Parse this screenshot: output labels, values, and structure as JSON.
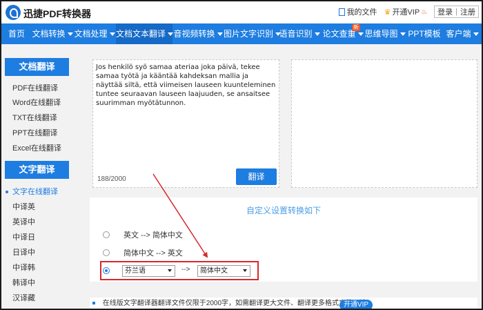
{
  "header": {
    "brand": "迅捷PDF转换器",
    "my_files": "我的文件",
    "open_vip": "开通VIP",
    "login": "登录",
    "sep": "|",
    "register": "注册"
  },
  "nav": {
    "items": [
      {
        "label": "首页",
        "caret": false
      },
      {
        "label": "文档转换",
        "caret": true
      },
      {
        "label": "文档处理",
        "caret": true
      },
      {
        "label": "文档文本翻译",
        "caret": true,
        "active": true
      },
      {
        "label": "音视频转换",
        "caret": true
      },
      {
        "label": "图片文字识别",
        "caret": true
      },
      {
        "label": "语音识别",
        "caret": true
      },
      {
        "label": "论文查重",
        "caret": true,
        "badge": "新"
      },
      {
        "label": "思维导图",
        "caret": true
      },
      {
        "label": "PPT模板",
        "caret": false
      },
      {
        "label": "客户端",
        "caret": true
      }
    ]
  },
  "sidebar": {
    "doc_heading": "文档翻译",
    "doc_items": [
      "PDF在线翻译",
      "Word在线翻译",
      "TXT在线翻译",
      "PPT在线翻译",
      "Excel在线翻译"
    ],
    "text_heading": "文字翻译",
    "text_items": [
      "文字在线翻译",
      "中译英",
      "英译中",
      "中译日",
      "日译中",
      "中译韩",
      "韩译中",
      "汉译藏"
    ]
  },
  "editor": {
    "source_text": "Jos henkilö syö samaa ateriaa joka päivä, tekee samaa työtä ja kääntää kahdeksan mallia ja näyttää siltä, että viimeisen lauseen kuunteleminen tuntee seuraavan lauseen laajuuden, se ansaitsee suurimman myötätunnon.",
    "counter": "188/2000",
    "translate_button": "翻译"
  },
  "settings": {
    "title": "自定义设置转换如下",
    "option1": "英文 --> 简体中文",
    "option2": "简体中文 --> 英文",
    "source_lang": "芬兰语",
    "arrow": "-->",
    "target_lang": "简体中文"
  },
  "notice": {
    "text": "在线版文字翻译器翻译文件仅限于2000字，如需翻译更大文件、翻译更多格式文件，请",
    "vip_button": "开通VIP"
  },
  "colors": {
    "accent": "#1e7de0",
    "highlight_red": "#d9262a"
  }
}
